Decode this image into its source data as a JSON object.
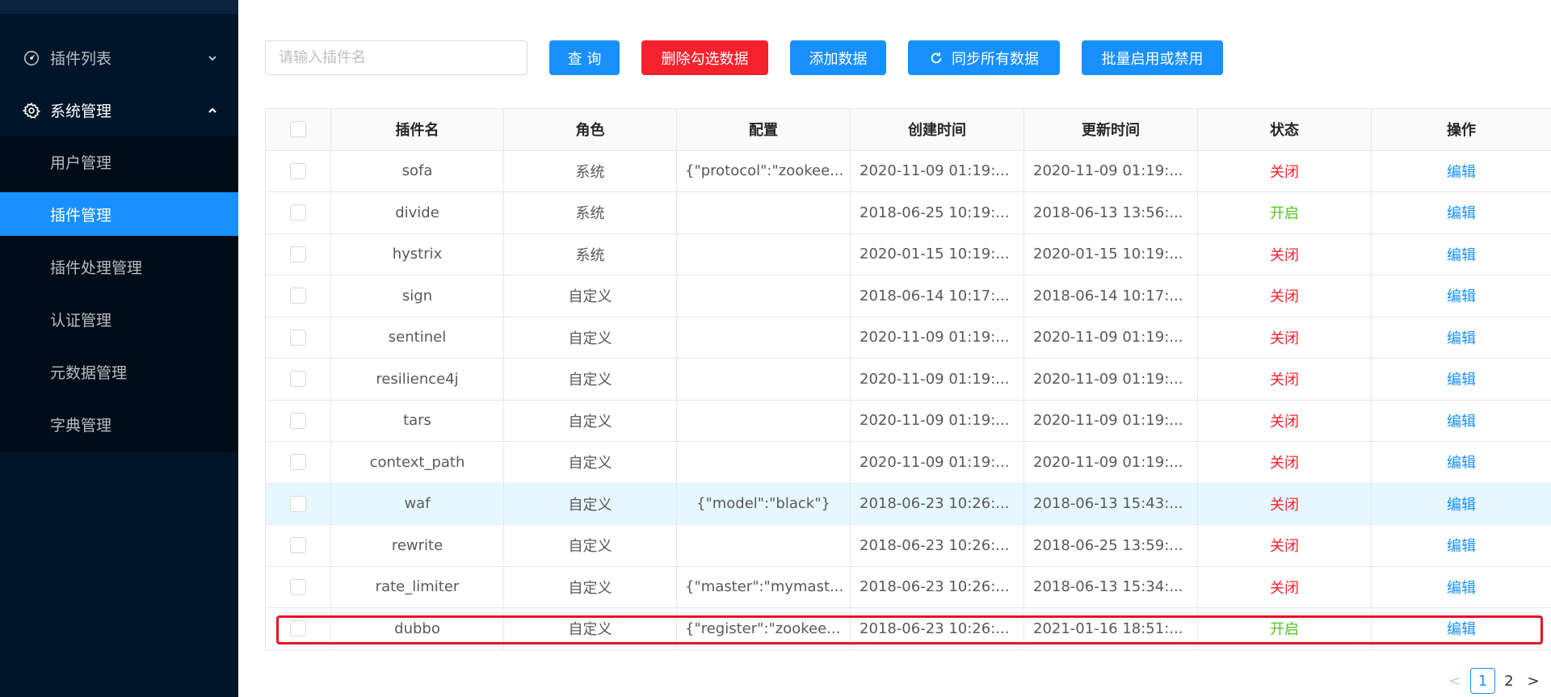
{
  "sidebar": {
    "menus": [
      {
        "label": "插件列表",
        "icon": "dashboard-icon",
        "expanded": false
      },
      {
        "label": "系统管理",
        "icon": "gear-icon",
        "expanded": true
      }
    ],
    "submenu": [
      {
        "label": "用户管理"
      },
      {
        "label": "插件管理",
        "active": true
      },
      {
        "label": "插件处理管理"
      },
      {
        "label": "认证管理"
      },
      {
        "label": "元数据管理"
      },
      {
        "label": "字典管理"
      }
    ],
    "colors": {
      "bg": "#001529",
      "submenu_bg": "#000c17",
      "active": "#1890ff"
    }
  },
  "toolbar": {
    "search_placeholder": "请输入插件名",
    "query_label": "查 询",
    "delete_label": "删除勾选数据",
    "add_label": "添加数据",
    "sync_label": "同步所有数据",
    "sync_icon": "refresh-icon",
    "batch_label": "批量启用或禁用"
  },
  "table": {
    "headers": [
      "插件名",
      "角色",
      "配置",
      "创建时间",
      "更新时间",
      "状态",
      "操作"
    ],
    "rows": [
      {
        "name": "sofa",
        "role": "系统",
        "config": "{\"protocol\":\"zookee...",
        "created": "2020-11-09 01:19:...",
        "updated": "2020-11-09 01:19:...",
        "status": "关闭",
        "action": "编辑"
      },
      {
        "name": "divide",
        "role": "系统",
        "config": "",
        "created": "2018-06-25 10:19:...",
        "updated": "2018-06-13 13:56:...",
        "status": "开启",
        "action": "编辑"
      },
      {
        "name": "hystrix",
        "role": "系统",
        "config": "",
        "created": "2020-01-15 10:19:...",
        "updated": "2020-01-15 10:19:...",
        "status": "关闭",
        "action": "编辑"
      },
      {
        "name": "sign",
        "role": "自定义",
        "config": "",
        "created": "2018-06-14 10:17:...",
        "updated": "2018-06-14 10:17:...",
        "status": "关闭",
        "action": "编辑"
      },
      {
        "name": "sentinel",
        "role": "自定义",
        "config": "",
        "created": "2020-11-09 01:19:...",
        "updated": "2020-11-09 01:19:...",
        "status": "关闭",
        "action": "编辑"
      },
      {
        "name": "resilience4j",
        "role": "自定义",
        "config": "",
        "created": "2020-11-09 01:19:...",
        "updated": "2020-11-09 01:19:...",
        "status": "关闭",
        "action": "编辑"
      },
      {
        "name": "tars",
        "role": "自定义",
        "config": "",
        "created": "2020-11-09 01:19:...",
        "updated": "2020-11-09 01:19:...",
        "status": "关闭",
        "action": "编辑"
      },
      {
        "name": "context_path",
        "role": "自定义",
        "config": "",
        "created": "2020-11-09 01:19:...",
        "updated": "2020-11-09 01:19:...",
        "status": "关闭",
        "action": "编辑"
      },
      {
        "name": "waf",
        "role": "自定义",
        "config": "{\"model\":\"black\"}",
        "created": "2018-06-23 10:26:...",
        "updated": "2018-06-13 15:43:...",
        "status": "关闭",
        "action": "编辑"
      },
      {
        "name": "rewrite",
        "role": "自定义",
        "config": "",
        "created": "2018-06-23 10:26:...",
        "updated": "2018-06-25 13:59:...",
        "status": "关闭",
        "action": "编辑"
      },
      {
        "name": "rate_limiter",
        "role": "自定义",
        "config": "{\"master\":\"mymast...",
        "created": "2018-06-23 10:26:...",
        "updated": "2018-06-13 15:34:...",
        "status": "关闭",
        "action": "编辑"
      },
      {
        "name": "dubbo",
        "role": "自定义",
        "config": "{\"register\":\"zookee...",
        "created": "2018-06-23 10:26:...",
        "updated": "2021-01-16 18:51:...",
        "status": "开启",
        "action": "编辑"
      }
    ],
    "hover_row": "waf",
    "highlighted_row": "dubbo",
    "colors": {
      "status_on": "#52c41a",
      "status_off": "#f5222d",
      "link": "#1890ff",
      "highlight_border": "#e81123"
    }
  },
  "pagination": {
    "prev": "<",
    "pages": [
      "1",
      "2"
    ],
    "current": "1",
    "next": ">"
  }
}
